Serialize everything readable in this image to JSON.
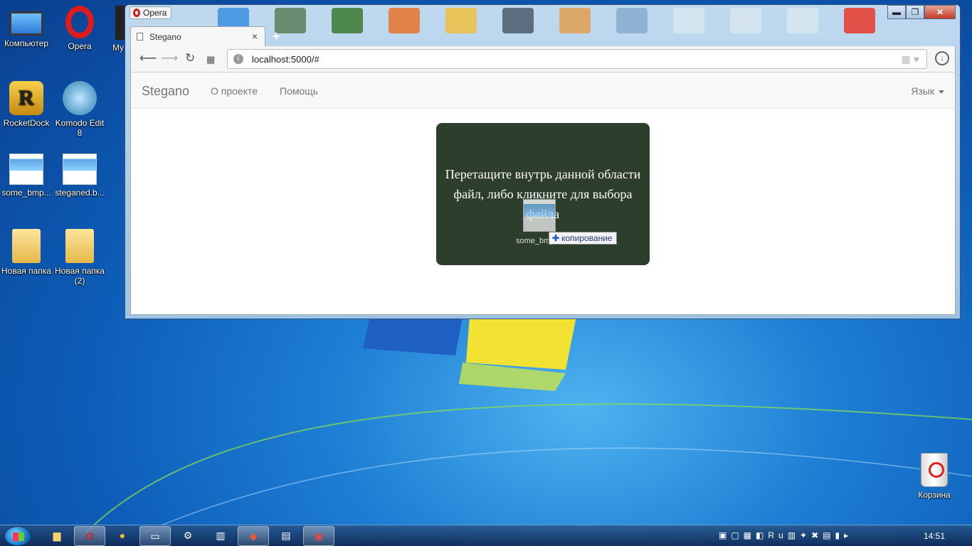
{
  "desktop": {
    "icons": [
      {
        "label": "Компьютер"
      },
      {
        "label": "Opera"
      },
      {
        "label": "My Co"
      },
      {
        "label": "RocketDock"
      },
      {
        "label": "Komodo Edit 8"
      },
      {
        "label": "some_bmp..."
      },
      {
        "label": "steganed.b..."
      },
      {
        "label": "Новая папка"
      },
      {
        "label": "Новая папка (2)"
      },
      {
        "label": "Корзина"
      }
    ]
  },
  "browser": {
    "app_badge": "Opera",
    "tab_title": "Stegano",
    "tab_close": "×",
    "new_tab": "+",
    "url": "localhost:5000/#",
    "window_controls": {
      "minimize": "▬",
      "maximize": "❐",
      "close": "✕"
    }
  },
  "page": {
    "brand": "Stegano",
    "nav": {
      "about": "О проекте",
      "help": "Помощь"
    },
    "language": "Язык",
    "dropzone_text": "Перетащите внутрь данной области файл, либо кликните для выбора файла",
    "drag_filename": "some_bmp",
    "copy_label": "копирование"
  },
  "taskbar": {
    "clock": "14:51",
    "tray_lang": "Ru"
  },
  "colors": {
    "dropzone_bg": "#2e3e2c",
    "navbar_bg": "#f8f8f8",
    "taskbar": "#1c3c66",
    "desktop": "#1e7fd4"
  }
}
